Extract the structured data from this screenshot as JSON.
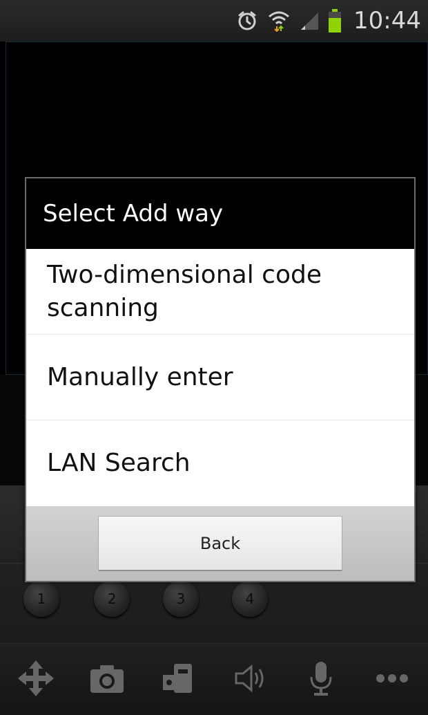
{
  "status_bar": {
    "time": "10:44",
    "icons": [
      "alarm-icon",
      "wifi-icon",
      "signal-icon",
      "battery-icon"
    ]
  },
  "dialog": {
    "title": "Select Add way",
    "options": [
      {
        "label": "Two-dimensional code scanning"
      },
      {
        "label": "Manually enter"
      },
      {
        "label": "LAN Search"
      }
    ],
    "back_label": "Back"
  },
  "presets": [
    "1",
    "2",
    "3",
    "4"
  ],
  "toolbar": {
    "icons": [
      "ptz-move-icon",
      "camera-icon",
      "video-record-icon",
      "speaker-icon",
      "microphone-icon",
      "more-icon"
    ]
  },
  "colors": {
    "battery": "#8fd400",
    "wifi_arrows": "#f0a020",
    "dialog_title_bg": "#000000",
    "list_bg": "#ffffff"
  }
}
